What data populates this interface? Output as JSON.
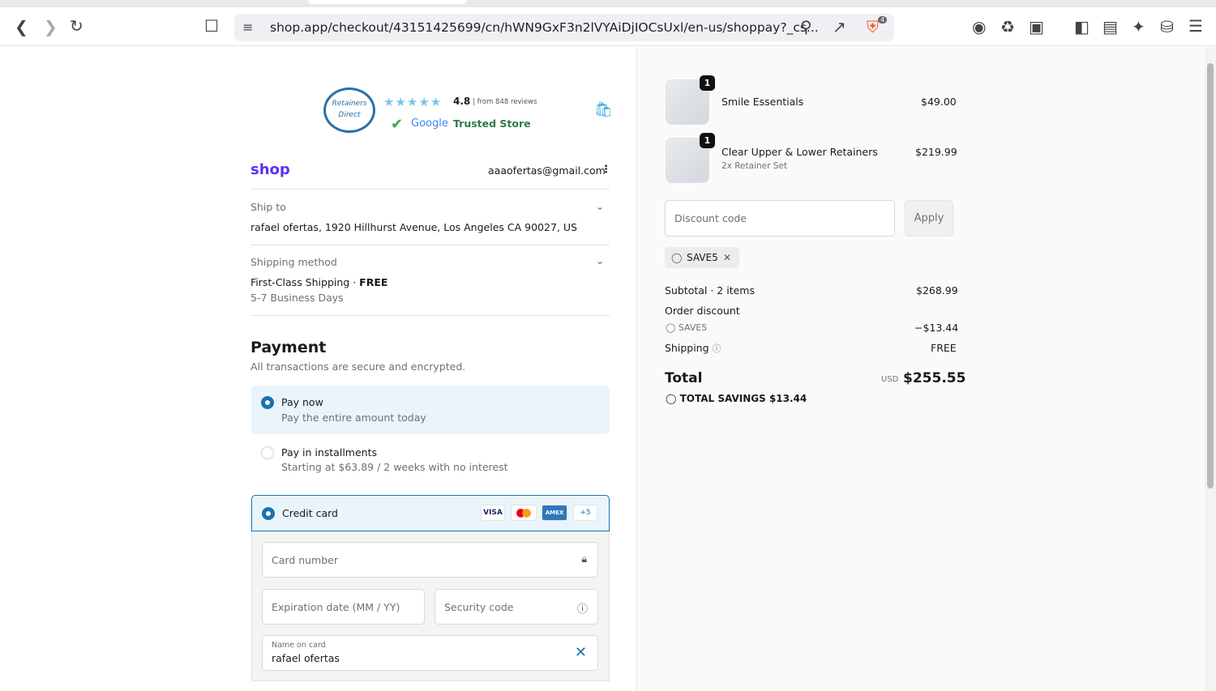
{
  "browser": {
    "url": "shop.app/checkout/43151425699/cn/hWN9GxF3n2lVYAiDjIOCsUxl/en-us/shoppay?_cs...",
    "shield_count": "4"
  },
  "store": {
    "logo_text": "RetainersDirect.com",
    "rating": "4.8",
    "reviews": "from 848 reviews",
    "google": "Google",
    "trusted": "Trusted Store"
  },
  "header": {
    "brand": "shop",
    "email": "aaaofertas@gmail.com"
  },
  "ship": {
    "label": "Ship to",
    "value": "rafael ofertas, 1920 Hillhurst Avenue, Los Angeles CA 90027, US"
  },
  "shipping_method": {
    "label": "Shipping method",
    "name": "First-Class Shipping",
    "sep": "·",
    "price": "FREE",
    "eta": "5-7 Business Days"
  },
  "payment": {
    "title": "Payment",
    "subtitle": "All transactions are secure and encrypted.",
    "options": [
      {
        "label": "Pay now",
        "desc": "Pay the entire amount today"
      },
      {
        "label": "Pay in installments",
        "desc": "Starting at $63.89 / 2 weeks with no interest"
      }
    ],
    "method": "Credit card",
    "cards": [
      "VISA",
      "AMEX",
      "+5"
    ],
    "card_number": "Card number",
    "expiry": "Expiration date (MM / YY)",
    "security": "Security code",
    "name_label": "Name on card",
    "name_value": "rafael ofertas"
  },
  "cart": {
    "items": [
      {
        "qty": "1",
        "name": "Smile Essentials",
        "variant": "",
        "price": "$49.00"
      },
      {
        "qty": "1",
        "name": "Clear Upper & Lower Retainers",
        "variant": "2x Retainer Set",
        "price": "$219.99"
      }
    ],
    "discount_placeholder": "Discount code",
    "apply": "Apply",
    "code": "SAVE5",
    "subtotal_label": "Subtotal · 2 items",
    "subtotal": "$268.99",
    "order_discount": "Order discount",
    "discount_code": "SAVE5",
    "discount_amount": "−$13.44",
    "shipping_label": "Shipping",
    "shipping": "FREE",
    "total_label": "Total",
    "currency": "USD",
    "total": "$255.55",
    "savings": "TOTAL SAVINGS $13.44"
  }
}
